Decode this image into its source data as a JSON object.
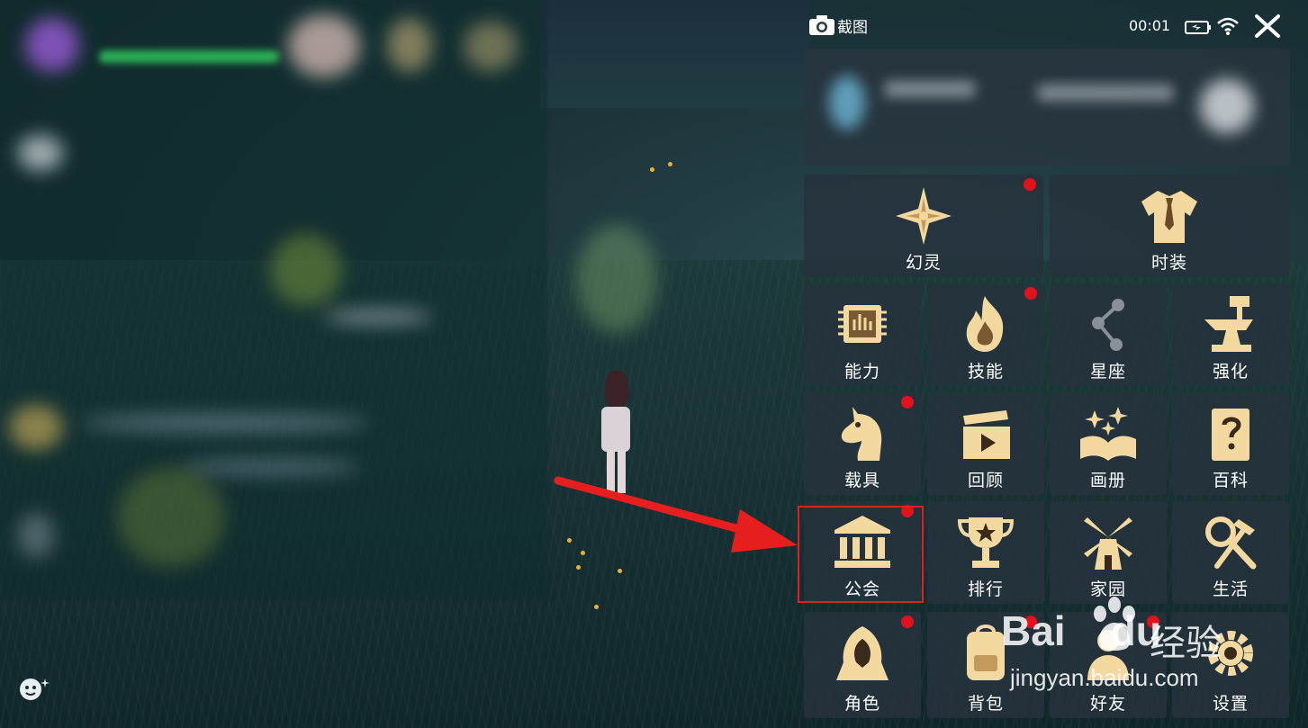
{
  "topbar": {
    "title": "截图",
    "time": "00:01",
    "icons": [
      "camera-icon",
      "battery-icon",
      "wifi-icon",
      "close-icon"
    ]
  },
  "menu": {
    "row1": [
      {
        "label": "幻灵",
        "icon": "compass-star-icon",
        "badge": true
      },
      {
        "label": "时装",
        "icon": "shirt-icon",
        "badge": false
      }
    ],
    "row2": [
      {
        "label": "能力",
        "icon": "chip-icon",
        "badge": false
      },
      {
        "label": "技能",
        "icon": "flame-icon",
        "badge": true
      },
      {
        "label": "星座",
        "icon": "constellation-icon",
        "badge": false
      },
      {
        "label": "强化",
        "icon": "anvil-icon",
        "badge": false
      }
    ],
    "row3": [
      {
        "label": "载具",
        "icon": "horse-icon",
        "badge": true
      },
      {
        "label": "回顾",
        "icon": "clapperboard-icon",
        "badge": false
      },
      {
        "label": "画册",
        "icon": "album-icon",
        "badge": false
      },
      {
        "label": "百科",
        "icon": "encyclopedia-icon",
        "badge": false
      }
    ],
    "row4": [
      {
        "label": "公会",
        "icon": "guild-hall-icon",
        "badge": true
      },
      {
        "label": "排行",
        "icon": "trophy-icon",
        "badge": false
      },
      {
        "label": "家园",
        "icon": "windmill-icon",
        "badge": false
      },
      {
        "label": "生活",
        "icon": "tools-icon",
        "badge": false
      }
    ],
    "row5": [
      {
        "label": "角色",
        "icon": "hooded-character-icon",
        "badge": true
      },
      {
        "label": "背包",
        "icon": "backpack-icon",
        "badge": true
      },
      {
        "label": "好友",
        "icon": "friends-icon",
        "badge": true
      },
      {
        "label": "设置",
        "icon": "gear-icon",
        "badge": false
      }
    ]
  },
  "annotation": {
    "highlight_target": "公会",
    "color": "#e02020"
  },
  "watermark": {
    "brand": "Bai",
    "brand_suffix": "du",
    "cn_text": "经验",
    "url": "jingyan.baidu.com"
  },
  "colors": {
    "icon_gold": "#f3d9a0",
    "tile_bg": "#26323c",
    "badge_red": "#e0121c"
  }
}
